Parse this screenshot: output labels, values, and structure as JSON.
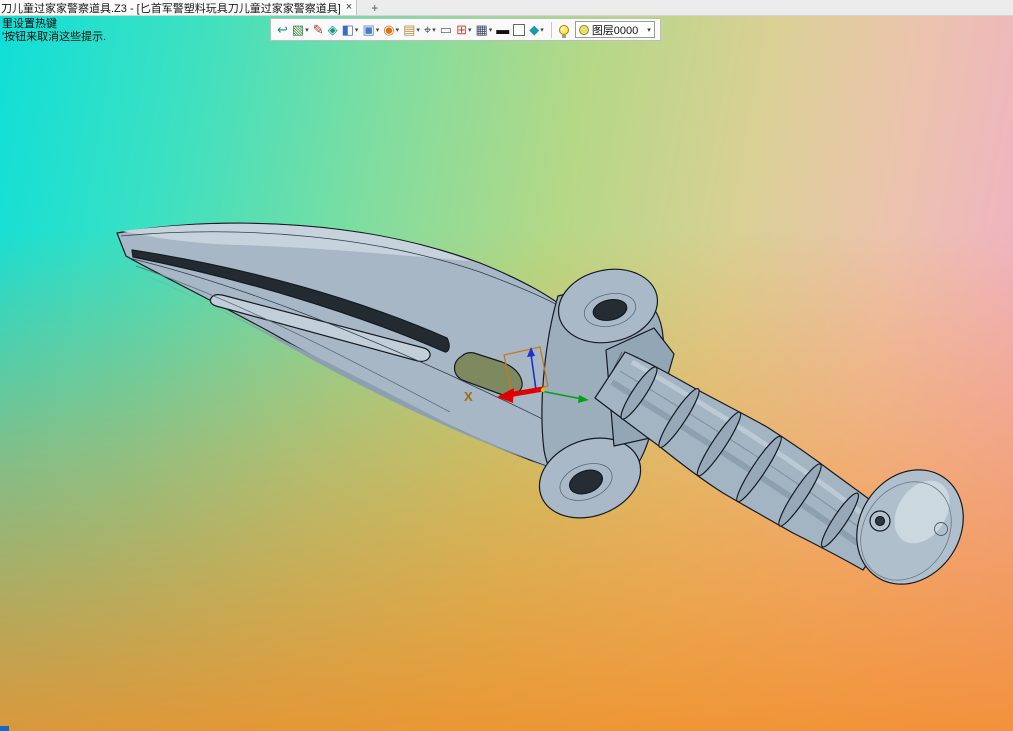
{
  "window": {
    "tab_title": "刀儿童过家家警察道具.Z3 - [匕首军警塑料玩具刀儿童过家家警察道具]",
    "tab_close": "×",
    "new_tab": "+"
  },
  "hints": {
    "line1": "里设置热键",
    "line2": "'按钮来取消这些提示."
  },
  "toolbar": {
    "caret": "▾",
    "icons": [
      {
        "name": "exit-icon",
        "glyph": "↩"
      },
      {
        "name": "render-mode-icon",
        "glyph": "▧"
      },
      {
        "name": "sketch-pen-icon",
        "glyph": "✎"
      },
      {
        "name": "iso-view-icon",
        "glyph": "◈"
      },
      {
        "name": "view-cube-icon",
        "glyph": "◧"
      },
      {
        "name": "window-mode-icon",
        "glyph": "▣"
      },
      {
        "name": "rotate-view-icon",
        "glyph": "◉"
      },
      {
        "name": "panel-icon",
        "glyph": "▤"
      },
      {
        "name": "locate-icon",
        "glyph": "⌖"
      },
      {
        "name": "select-rect-icon",
        "glyph": "▭"
      },
      {
        "name": "section-view-icon",
        "glyph": "⊞"
      },
      {
        "name": "display-mode-icon",
        "glyph": "▦"
      },
      {
        "name": "line-width-icon",
        "glyph": "▬"
      },
      {
        "name": "white-swatch-icon",
        "glyph": ""
      },
      {
        "name": "surface-shape-icon",
        "glyph": "◆"
      }
    ],
    "layer": {
      "label": "图层0000"
    }
  },
  "viewport": {
    "axis_x_label": "X"
  },
  "colors": {
    "bg_top_left": "#12e0da",
    "bg_top_right": "#f0b2c6",
    "bg_bottom": "#f0a04a",
    "model_fill": "#a7b7c5",
    "model_edge": "#151a23",
    "axis_x": "#e00000",
    "axis_y": "#00a018",
    "axis_z": "#2030c8",
    "plane_outline": "#c8781c"
  }
}
